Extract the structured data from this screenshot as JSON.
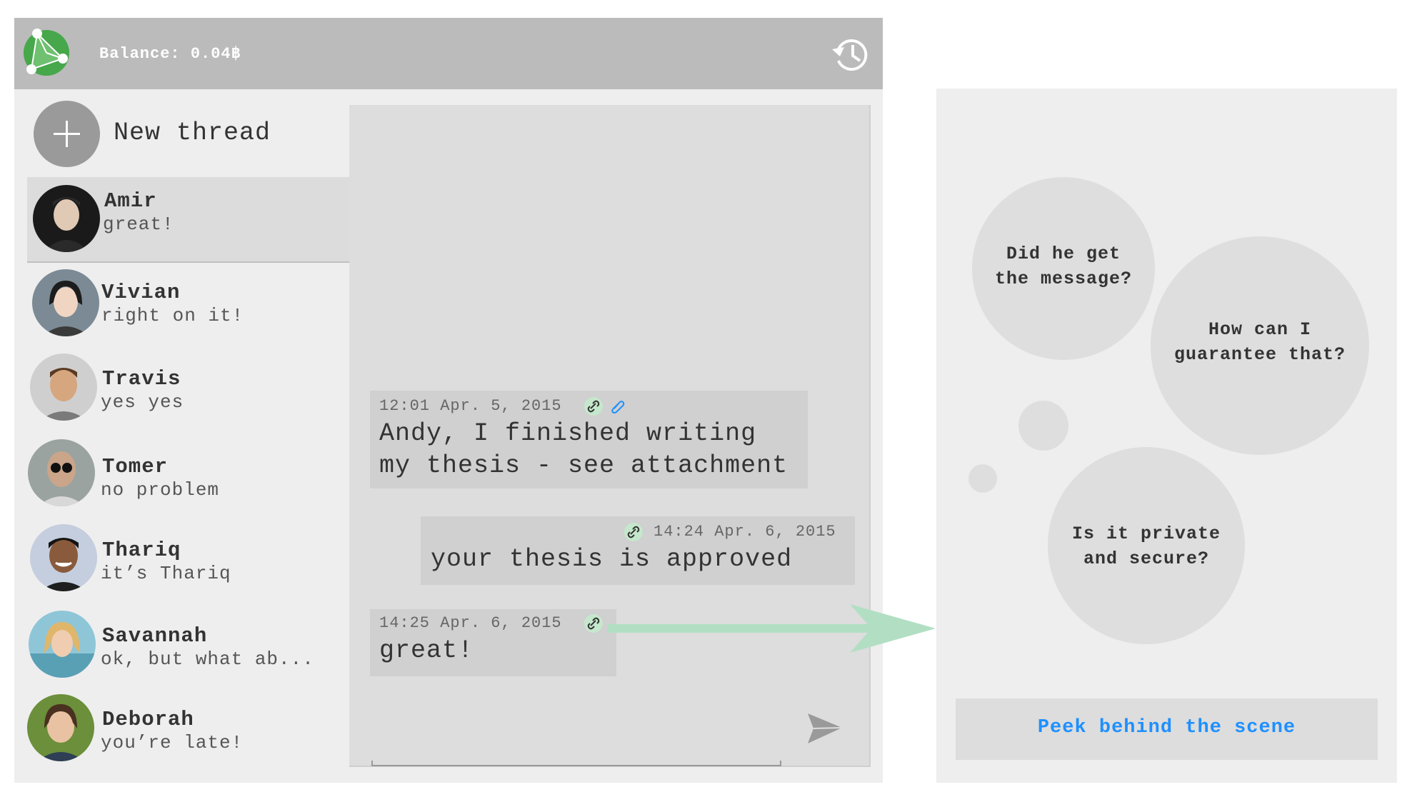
{
  "header": {
    "balance": "Balance: 0.04฿",
    "logo_icon": "network-logo-icon",
    "history_icon": "history-icon"
  },
  "sidebar": {
    "new_thread_label": "New thread",
    "contacts": [
      {
        "name": "Amir",
        "last_message": "great!",
        "active": true
      },
      {
        "name": "Vivian",
        "last_message": "right on it!"
      },
      {
        "name": "Travis",
        "last_message": "yes yes"
      },
      {
        "name": "Tomer",
        "last_message": "no problem"
      },
      {
        "name": "Thariq",
        "last_message": "it’s Thariq"
      },
      {
        "name": "Savannah",
        "last_message": "ok, but what ab..."
      },
      {
        "name": "Deborah",
        "last_message": "you’re late!"
      }
    ]
  },
  "chat": {
    "messages": [
      {
        "timestamp": "12:01 Apr. 5, 2015",
        "text_line1": "Andy, I finished writing",
        "text_line2": "my thesis - see attachment",
        "icons": [
          "link-icon",
          "paperclip-icon"
        ]
      },
      {
        "timestamp": "14:24 Apr. 6, 2015",
        "text": "your thesis is approved",
        "icons": [
          "link-icon"
        ]
      },
      {
        "timestamp": "14:25 Apr. 6, 2015",
        "text": "great!",
        "icons": [
          "link-icon"
        ]
      }
    ],
    "compose_value": "",
    "send_icon": "send-icon"
  },
  "right_panel": {
    "bubbles": [
      {
        "line1": "Did he get",
        "line2": "the message?"
      },
      {
        "line1": "How can I",
        "line2": "guarantee that?"
      },
      {
        "line1": "Is it private",
        "line2": "and secure?"
      }
    ],
    "peek_label": "Peek behind the scene"
  },
  "colors": {
    "header": "#bbbbbb",
    "accent_green": "#4caf50",
    "arrow_green": "#b2dfc4",
    "link_blue": "#1e90ff"
  }
}
